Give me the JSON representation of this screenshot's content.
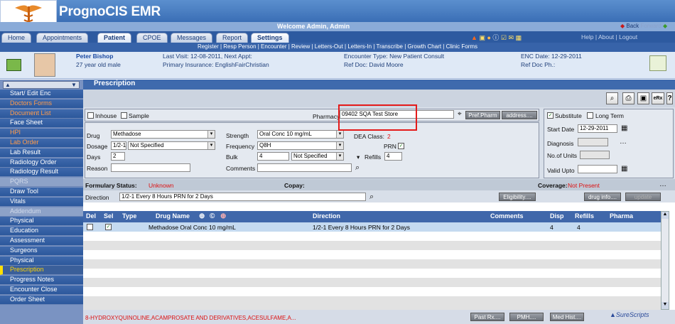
{
  "app": {
    "title": "PrognoCIS EMR",
    "welcome": "Welcome Admin, Admin",
    "back": "Back",
    "fwd": "Forward"
  },
  "tabs": [
    "Home",
    "Appointments",
    "Patient",
    "CPOE",
    "Messages",
    "Report",
    "Settings"
  ],
  "toplinks": "Help | About | Logout",
  "subnav": "Register | Resp Person | Encounter | Review | Letters-Out | Letters-In | Transcribe | Growth Chart | Clinic Forms",
  "patient": {
    "name": "Peter Bishop",
    "age": "27 year old male",
    "last_visit": "Last Visit: 12-08-2011, Next Appt:",
    "insurance": "Primary Insurance: EnglishFairChristian",
    "enc_type": "Encounter Type: New Patient Consult",
    "ref_doc": "Ref Doc: David Moore",
    "enc_date": "ENC Date: 12-29-2011",
    "ref_doc_ph": "Ref Doc Ph.:"
  },
  "sidebar": [
    {
      "label": "Start/ Edit Enc",
      "style": ""
    },
    {
      "label": "Doctors Forms",
      "style": "orange"
    },
    {
      "label": "Document List",
      "style": "orange"
    },
    {
      "label": "Face Sheet",
      "style": ""
    },
    {
      "label": "HPI",
      "style": "orange"
    },
    {
      "label": "Lab Order",
      "style": "orange"
    },
    {
      "label": "Lab Result",
      "style": ""
    },
    {
      "label": "Radiology Order",
      "style": ""
    },
    {
      "label": "Radiology Result",
      "style": ""
    },
    {
      "label": "PQRS",
      "style": "gray"
    },
    {
      "label": "Draw Tool",
      "style": ""
    },
    {
      "label": "Vitals",
      "style": ""
    },
    {
      "label": "Addendum",
      "style": "gray"
    },
    {
      "label": "Physical",
      "style": ""
    },
    {
      "label": "Education",
      "style": ""
    },
    {
      "label": "Assessment",
      "style": ""
    },
    {
      "label": "Surgeons",
      "style": ""
    },
    {
      "label": "Physical",
      "style": ""
    },
    {
      "label": "Prescription",
      "style": "active"
    },
    {
      "label": "Progress Notes",
      "style": ""
    },
    {
      "label": "Encounter Close",
      "style": ""
    },
    {
      "label": "Order Sheet",
      "style": ""
    }
  ],
  "rx": {
    "header": "Prescription",
    "erx": "eRx",
    "help": "?",
    "inhouse": "Inhouse",
    "sample": "Sample",
    "pharmacy_label": "Pharmacy",
    "pharmacy": "09402 SQA Test Store",
    "pref_pharm": "Pref.Pharm",
    "address": "address....",
    "substitute": "Substitute",
    "long_term": "Long Term",
    "drug_label": "Drug",
    "drug": "Methadose",
    "strength_label": "Strength",
    "strength": "Oral Conc 10 mg/mL",
    "dea_label": "DEA Class:",
    "dea": "2",
    "dosage_label": "Dosage",
    "dosage": "1/2-1",
    "dosage_unit": "Not Specified",
    "frequency_label": "Frequency",
    "frequency": "Q8H",
    "prn": "PRN",
    "days_label": "Days",
    "days": "2",
    "bulk_label": "Bulk",
    "bulk": "4",
    "bulk_unit": "Not Specified",
    "refills_label": "Refills",
    "refills": "4",
    "reason_label": "Reason",
    "comments_label": "Comments",
    "start_date_label": "Start Date",
    "start_date": "12-29-2011",
    "diagnosis_label": "Diagnosis",
    "units_label": "No.of Units",
    "valid_label": "Valid Upto",
    "formulary_label": "Formulary Status:",
    "formulary": "Unknown",
    "copay_label": "Copay:",
    "coverage_label": "Coverage:",
    "coverage": "Not Present",
    "direction_label": "Direction",
    "direction": "1/2-1 Every 8 Hours PRN for 2 Days",
    "eligibility": "Eligibility....",
    "drug_info": "drug info....",
    "update": "update"
  },
  "table": {
    "columns": [
      "Del",
      "Sel",
      "Type",
      "Drug Name",
      "Direction",
      "Comments",
      "Disp",
      "Refills",
      "Pharma"
    ],
    "rows": [
      {
        "drug": "Methadose  Oral Conc 10 mg/mL",
        "direction": "1/2-1 Every 8 Hours PRN for 2 Days",
        "disp": "4",
        "refills": "4"
      }
    ]
  },
  "bottom": {
    "allergies": "8-HYDROXYQUINOLINE,ACAMPROSATE AND DERIVATIVES,ACESULFAME,A...",
    "past_rx": "Past Rx....",
    "pmh": "PMH....",
    "med_hist": "Med Hist....",
    "surescripts": "SureScripts"
  }
}
